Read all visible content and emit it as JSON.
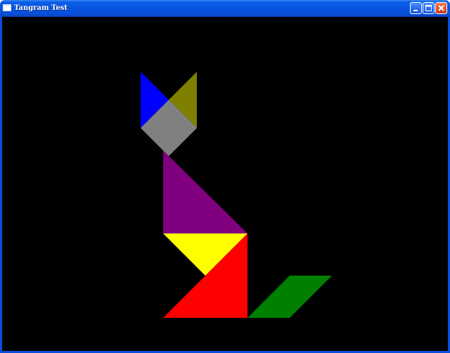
{
  "window": {
    "title": "Tangram Test",
    "controls": {
      "minimize_icon": "minimize-icon",
      "maximize_icon": "maximize-icon",
      "close_icon": "close-icon"
    }
  },
  "scene": {
    "background": "#000000",
    "pieces": [
      {
        "name": "blue-ear-triangle",
        "color": "#0000ff"
      },
      {
        "name": "olive-ear-triangle",
        "color": "#808000"
      },
      {
        "name": "gray-head-square",
        "color": "#808080"
      },
      {
        "name": "purple-body-triangle",
        "color": "#800080"
      },
      {
        "name": "yellow-body-triangle",
        "color": "#ffff00"
      },
      {
        "name": "red-body-triangle",
        "color": "#ff0000"
      },
      {
        "name": "green-tail-parallelogram",
        "color": "#008000"
      }
    ]
  }
}
